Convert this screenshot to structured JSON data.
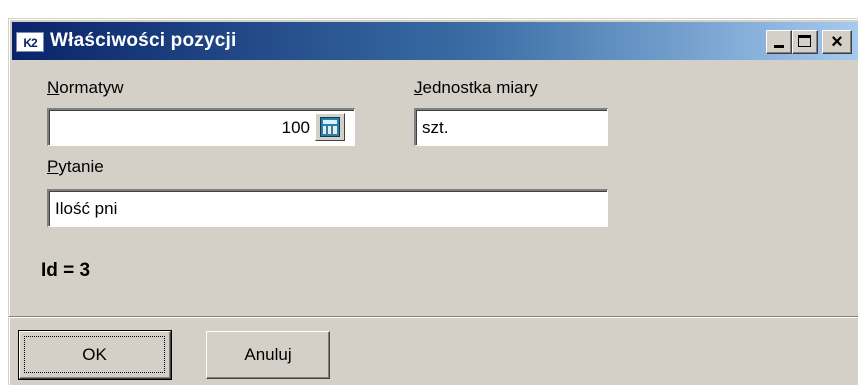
{
  "window": {
    "title": "Właściwości pozycji",
    "app_icon_text": "K2"
  },
  "titlebar_buttons": {
    "minimize": "_",
    "maximize": "□",
    "close": "×"
  },
  "form": {
    "normatyw_label_prefix": "N",
    "normatyw_label_rest": "ormatyw",
    "normatyw_value": "100",
    "jednostka_label_prefix": "J",
    "jednostka_label_rest": "ednostka miary",
    "jednostka_value": "szt.",
    "pytanie_label_prefix": "P",
    "pytanie_label_rest": "ytanie",
    "pytanie_value": "Ilość pni",
    "id_text": "Id = 3"
  },
  "buttons": {
    "ok_label": "OK",
    "cancel_label": "Anuluj"
  }
}
